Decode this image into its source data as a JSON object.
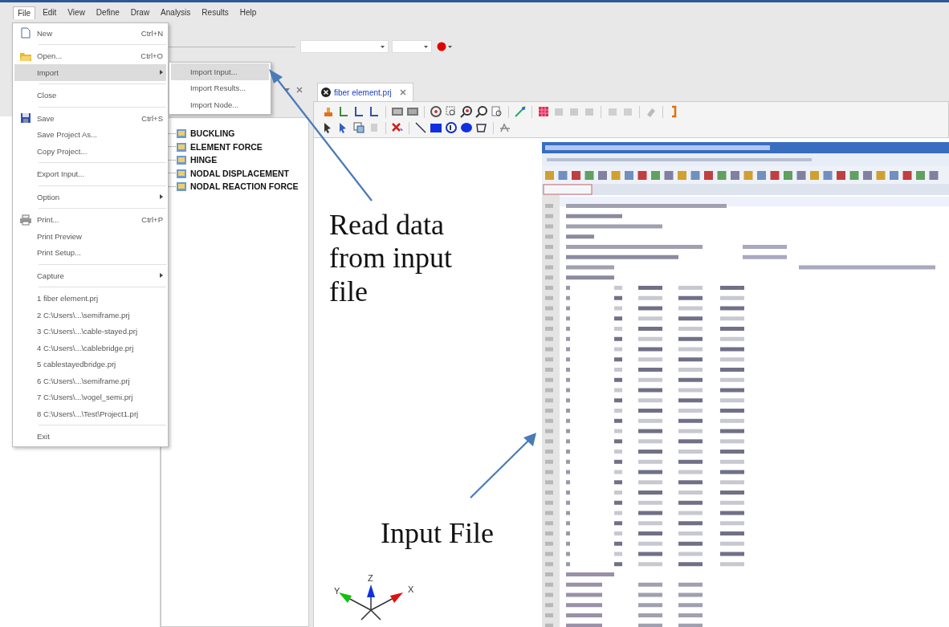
{
  "menubar": [
    {
      "label": "File",
      "selected": true
    },
    {
      "label": "Edit",
      "selected": false
    },
    {
      "label": "View",
      "selected": false
    },
    {
      "label": "Define",
      "selected": false
    },
    {
      "label": "Draw",
      "selected": false
    },
    {
      "label": "Analysis",
      "selected": false
    },
    {
      "label": "Results",
      "selected": false
    },
    {
      "label": "Help",
      "selected": false
    }
  ],
  "file_menu": {
    "groups": [
      [
        {
          "label": "New",
          "shortcut": "Ctrl+N",
          "kind": "document",
          "submenu": false,
          "selected": false
        }
      ],
      [
        {
          "label": "Open...",
          "shortcut": "Ctrl+O",
          "kind": "folder",
          "submenu": false,
          "selected": false
        },
        {
          "label": "Import",
          "kind": "plain",
          "submenu": true,
          "selected": true
        }
      ],
      [
        {
          "label": "Close",
          "kind": "plain",
          "submenu": false,
          "selected": false
        }
      ],
      [
        {
          "label": "Save",
          "shortcut": "Ctrl+S",
          "kind": "disk",
          "submenu": false,
          "selected": false
        },
        {
          "label": "Save Project As...",
          "kind": "plain",
          "submenu": false,
          "selected": false
        },
        {
          "label": "Copy Project...",
          "kind": "plain",
          "submenu": false,
          "selected": false
        }
      ],
      [
        {
          "label": "Export Input...",
          "kind": "plain",
          "submenu": false,
          "selected": false
        }
      ],
      [
        {
          "label": "Option",
          "kind": "plain",
          "submenu": true,
          "selected": false
        }
      ],
      [
        {
          "label": "Print...",
          "shortcut": "Ctrl+P",
          "kind": "printer",
          "submenu": false,
          "selected": false
        },
        {
          "label": "Print Preview",
          "kind": "plain",
          "submenu": false,
          "selected": false
        },
        {
          "label": "Print Setup...",
          "kind": "plain",
          "submenu": false,
          "selected": false
        }
      ],
      [
        {
          "label": "Capture",
          "kind": "plain",
          "submenu": true,
          "selected": false
        }
      ],
      [
        {
          "label": "1 fiber element.prj",
          "kind": "plain",
          "submenu": false,
          "selected": false
        },
        {
          "label": "2 C:\\Users\\...\\semiframe.prj",
          "kind": "plain",
          "submenu": false,
          "selected": false
        },
        {
          "label": "3 C:\\Users\\...\\cable-stayed.prj",
          "kind": "plain",
          "submenu": false,
          "selected": false
        },
        {
          "label": "4 C:\\Users\\...\\cablebridge.prj",
          "kind": "plain",
          "submenu": false,
          "selected": false
        },
        {
          "label": "5 cablestayedbridge.prj",
          "kind": "plain",
          "submenu": false,
          "selected": false
        },
        {
          "label": "6 C:\\Users\\...\\semiframe.prj",
          "kind": "plain",
          "submenu": false,
          "selected": false
        },
        {
          "label": "7 C:\\Users\\...\\vogel_semi.prj",
          "kind": "plain",
          "submenu": false,
          "selected": false
        },
        {
          "label": "8 C:\\Users\\...\\Test\\Project1.prj",
          "kind": "plain",
          "submenu": false,
          "selected": false
        }
      ],
      [
        {
          "label": "Exit",
          "kind": "plain",
          "submenu": false,
          "selected": false
        }
      ]
    ]
  },
  "import_submenu": [
    {
      "label": "Import Input...",
      "selected": true
    },
    {
      "label": "Import Results...",
      "selected": false
    },
    {
      "label": "Import Node...",
      "selected": false
    }
  ],
  "tree": {
    "items": [
      {
        "label": "BUCKLING"
      },
      {
        "label": "ELEMENT FORCE"
      },
      {
        "label": "HINGE"
      },
      {
        "label": "NODAL DISPLACEMENT"
      },
      {
        "label": "NODAL REACTION FORCE"
      }
    ]
  },
  "document_tab": {
    "label": "fiber element.prj",
    "selected": true
  },
  "annotations": [
    {
      "text": "Read data from input file"
    },
    {
      "text": "Input File"
    }
  ],
  "axis_labels": [
    "Y",
    "Z",
    "X"
  ]
}
